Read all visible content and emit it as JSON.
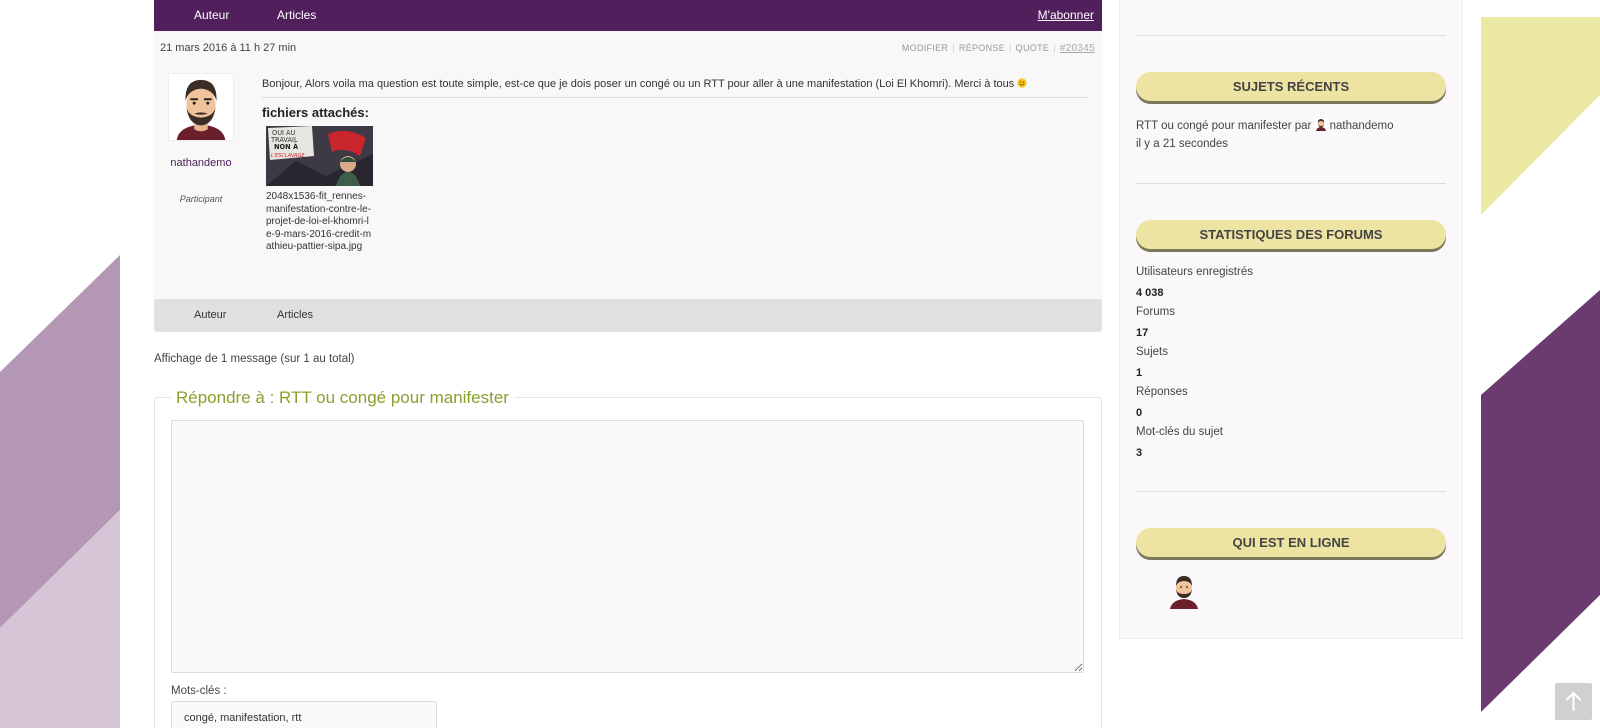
{
  "forum": {
    "header": {
      "author_col": "Auteur",
      "posts_col": "Articles",
      "subscribe": "M'abonner"
    },
    "post": {
      "date": "21 mars 2016 à 11 h 27 min",
      "actions": {
        "edit": "MODIFIER",
        "reply": "RÉPONSE",
        "quote": "QUOTE",
        "permalink": "#20345"
      },
      "author": {
        "name": "nathandemo",
        "role": "Participant"
      },
      "body": "Bonjour, Alors voila ma question est toute simple, est-ce que je dois poser un congé ou un RTT pour aller à une manifestation (Loi El Khomri). Merci à tous",
      "attachments_title": "fichiers attachés:",
      "attachment_filename": "2048x1536-fit_rennes-manifestation-contre-le-projet-de-loi-el-khomri-le-9-mars-2016-credit-mathieu-pattier-sipa.jpg",
      "attachment_sign_lines": [
        "OUI AU",
        "TRAVAIL",
        "NON À",
        "L'ESCLAVAGE"
      ]
    },
    "footer": {
      "author_col": "Auteur",
      "posts_col": "Articles"
    },
    "pagination_text": "Affichage de 1 message (sur 1 au total)",
    "reply_form": {
      "legend": "Répondre à : RTT ou congé pour manifester",
      "textarea_value": "",
      "tags_label": "Mots-clés :",
      "tags_value": "congé, manifestation, rtt"
    }
  },
  "sidebar": {
    "recent_topics": {
      "title": "SUJETS RÉCENTS",
      "topic_title": "RTT ou congé pour manifester",
      "by": "par",
      "author": "nathandemo",
      "time": "il y a 21 secondes"
    },
    "stats": {
      "title": "STATISTIQUES DES FORUMS",
      "items": [
        {
          "label": "Utilisateurs enregistrés",
          "value": "4 038"
        },
        {
          "label": "Forums",
          "value": "17"
        },
        {
          "label": "Sujets",
          "value": "1"
        },
        {
          "label": "Réponses",
          "value": "0"
        },
        {
          "label": "Mot-clés du sujet",
          "value": "3"
        }
      ]
    },
    "online": {
      "title": "QUI EST EN LIGNE"
    }
  },
  "icons": {
    "emoji": "smiley-icon",
    "scroll_top": "arrow-up-icon"
  },
  "colors": {
    "brand_purple": "#51205c",
    "title_pill": "#ede4a3",
    "legend_green": "#88a02e",
    "bg_lilac": "#b497b4",
    "bg_purple": "#6b3a6e",
    "bg_yellow": "#ece9a4"
  }
}
